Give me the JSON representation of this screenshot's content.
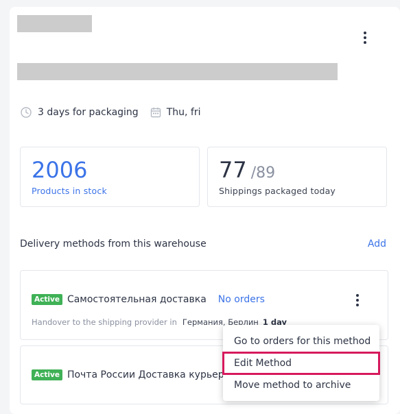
{
  "header": {
    "more_icon": "vertical-ellipsis"
  },
  "meta": {
    "packaging_icon": "clock-icon",
    "packaging": "3 days for packaging",
    "days_icon": "calendar-icon",
    "days": "Thu, fri"
  },
  "stats": {
    "stock": {
      "value": "2006",
      "label": "Products in stock",
      "color": "#3b73e8"
    },
    "packaged": {
      "value": "77",
      "total": "/89",
      "label": "Shippings packaged today"
    }
  },
  "delivery": {
    "section_title": "Delivery methods from this warehouse",
    "add_label": "Add",
    "methods": [
      {
        "status": "Active",
        "name": "Самостоятельная доставка",
        "orders_link": "No orders",
        "handover_label": "Handover to the shipping provider in",
        "location": "Германия, Берлин",
        "duration": "1 day"
      },
      {
        "status": "Active",
        "name": "Почта России Доставка курьер"
      }
    ]
  },
  "menu": {
    "items": [
      "Go to orders for this method",
      "Edit Method",
      "Move method to archive"
    ],
    "highlighted_index": 1
  },
  "colors": {
    "accent": "#3b73e8",
    "active_badge": "#3fb156",
    "highlight": "#d6195c"
  }
}
